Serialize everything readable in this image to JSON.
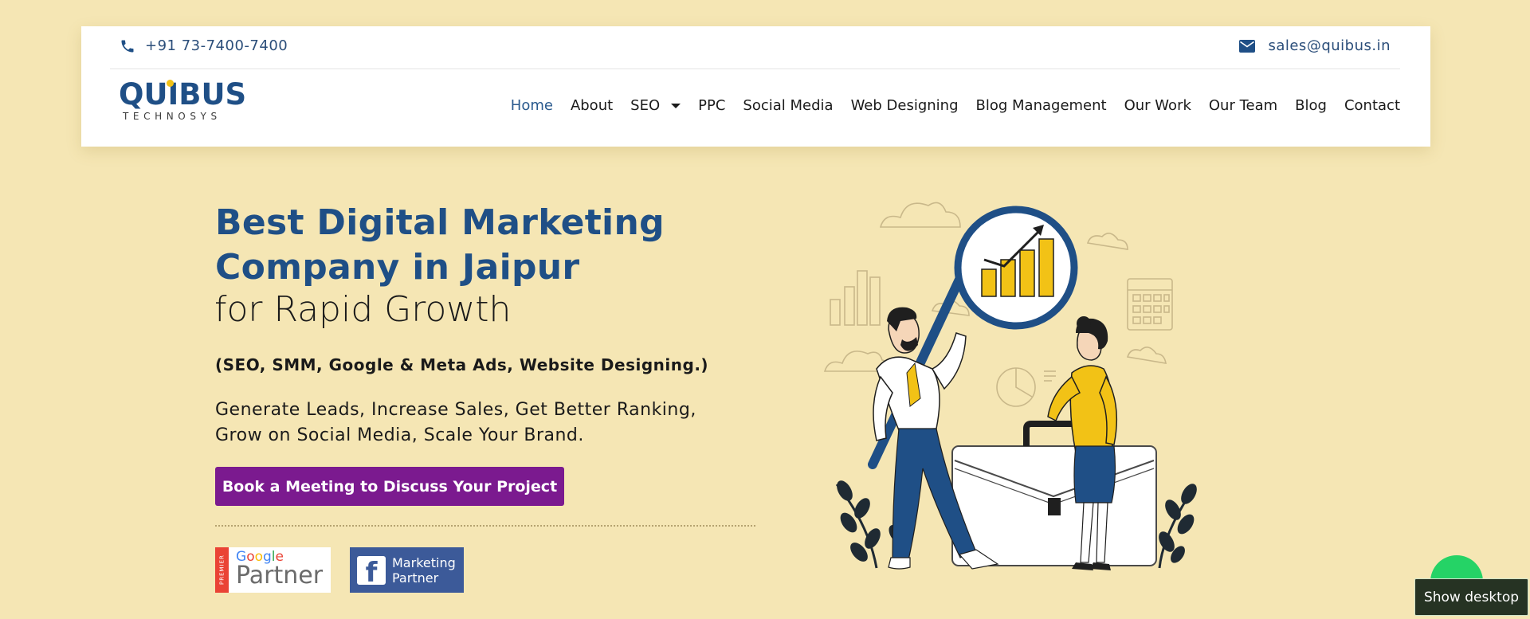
{
  "topbar": {
    "phone": "+91 73-7400-7400",
    "email": "sales@quibus.in",
    "phone_icon": "phone-icon",
    "email_icon": "envelope-icon"
  },
  "logo": {
    "word": "QUIBUS",
    "tagline": "TECHNOSYS"
  },
  "nav": {
    "items": [
      {
        "label": "Home"
      },
      {
        "label": "About"
      },
      {
        "label": "SEO"
      },
      {
        "label": "PPC"
      },
      {
        "label": "Social Media"
      },
      {
        "label": "Web Designing"
      },
      {
        "label": "Blog Management"
      },
      {
        "label": "Our Work"
      },
      {
        "label": "Our Team"
      },
      {
        "label": "Blog"
      },
      {
        "label": "Contact"
      }
    ],
    "active": "Home"
  },
  "hero": {
    "title_line1": "Best Digital Marketing",
    "title_line2": "Company in Jaipur",
    "subtitle": "for Rapid Growth",
    "services": "(SEO, SMM, Google & Meta Ads, Website Designing.)",
    "desc_line1": "Generate Leads, Increase Sales, Get Better Ranking,",
    "desc_line2": "Grow on Social Media, Scale Your Brand.",
    "cta_label": "Book a Meeting to Discuss Your Project"
  },
  "badges": {
    "google_strip": "PREMIER",
    "google_word": "Google",
    "google_partner": "Partner",
    "fb_line1": "Marketing",
    "fb_line2": "Partner"
  },
  "overlay": {
    "tooltip": "Show desktop"
  },
  "colors": {
    "background": "#f5e6b4",
    "brand_blue": "#1f4f86",
    "cta_purple": "#7b1a8f",
    "accent_yellow": "#f2c216"
  }
}
